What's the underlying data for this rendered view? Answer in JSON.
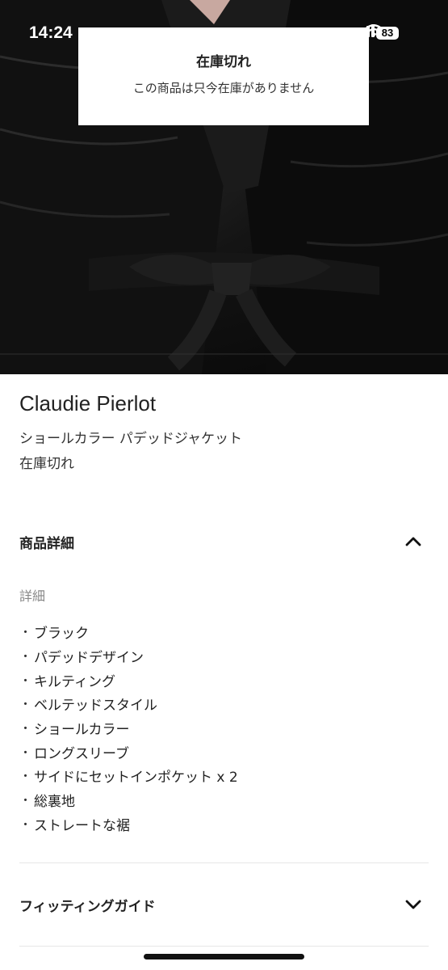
{
  "status_bar": {
    "time": "14:24",
    "battery": "83"
  },
  "toast": {
    "title": "在庫切れ",
    "message": "この商品は只今在庫がありません"
  },
  "product": {
    "brand": "Claudie Pierlot",
    "name": "ショールカラー パデッドジャケット",
    "stock_status": "在庫切れ"
  },
  "details_section": {
    "title": "商品詳細",
    "expanded": true,
    "label": "詳細",
    "features": [
      "ブラック",
      "パデッドデザイン",
      "キルティング",
      "ベルテッドスタイル",
      "ショールカラー",
      "ロングスリーブ",
      "サイドにセットインポケット x 2",
      "総裏地",
      "ストレートな裾"
    ]
  },
  "fitting_section": {
    "title": "フィッティングガイド",
    "expanded": false
  },
  "icons": {
    "signal": "signal-icon",
    "wifi": "wifi-icon",
    "collapse": "chevron-up-icon",
    "expand": "chevron-down-icon"
  },
  "colors": {
    "background": "#ffffff",
    "text": "#222222",
    "muted": "#888888",
    "divider": "#e6e6e6"
  }
}
